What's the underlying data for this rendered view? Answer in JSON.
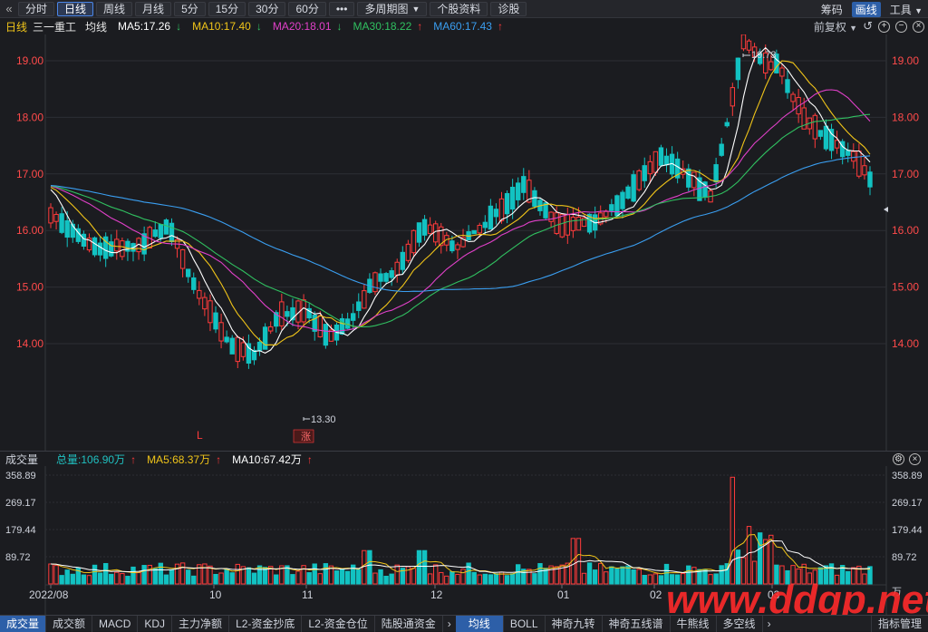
{
  "toolbar": {
    "back_icon": "«",
    "buttons": [
      {
        "label": "分时",
        "active": false
      },
      {
        "label": "日线",
        "active": true
      },
      {
        "label": "周线",
        "active": false
      },
      {
        "label": "月线",
        "active": false
      },
      {
        "label": "5分",
        "active": false
      },
      {
        "label": "15分",
        "active": false
      },
      {
        "label": "30分",
        "active": false
      },
      {
        "label": "60分",
        "active": false
      },
      {
        "label": "•••",
        "active": false
      },
      {
        "label": "多周期图",
        "active": false,
        "dropdown": true
      },
      {
        "label": "个股资料",
        "active": false
      },
      {
        "label": "诊股",
        "active": false
      }
    ],
    "right": {
      "chips": "筹码",
      "draw": "画线",
      "tools": "工具"
    }
  },
  "ma_header": {
    "period": "日线",
    "stock_name": "三一重工",
    "avg_line": "均线",
    "items": [
      {
        "label": "MA5:17.26",
        "arrow": "↓",
        "color": "#ffffff"
      },
      {
        "label": "MA10:17.40",
        "arrow": "↓",
        "color": "#f0c419"
      },
      {
        "label": "MA20:18.01",
        "arrow": "↓",
        "color": "#e040c8"
      },
      {
        "label": "MA30:18.22",
        "arrow": "↑",
        "color": "#30c060"
      },
      {
        "label": "MA60:17.43",
        "arrow": "↑",
        "color": "#3a9ef0"
      }
    ],
    "restore": "前复权"
  },
  "price_axis": {
    "ticks": [
      "19.00",
      "18.00",
      "17.00",
      "16.00",
      "15.00",
      "14.00"
    ],
    "tick_values": [
      19,
      18,
      17,
      16,
      15,
      14
    ]
  },
  "annotations": {
    "high": "19.73",
    "low": "13.30",
    "marker_l": "L",
    "marker_zhang": "涨"
  },
  "volume_header": {
    "title": "成交量",
    "items": [
      {
        "label": "总量:106.90万",
        "arrow": "↑",
        "color": "#20c0c0"
      },
      {
        "label": "MA5:68.37万",
        "arrow": "↑",
        "color": "#f0c419"
      },
      {
        "label": "MA10:67.42万",
        "arrow": "↑",
        "color": "#ffffff"
      }
    ]
  },
  "volume_axis": {
    "ticks": [
      "358.89",
      "269.17",
      "179.44",
      "89.72"
    ],
    "unit": "万"
  },
  "date_axis": [
    "2022/08",
    "10",
    "11",
    "12",
    "01",
    "02",
    "03"
  ],
  "bottom_tabs_left": [
    "成交量",
    "成交额",
    "MACD",
    "KDJ",
    "主力净额",
    "L2-资金抄底",
    "L2-资金仓位",
    "陆股通资金"
  ],
  "bottom_tabs_right": [
    "均线",
    "BOLL",
    "神奇九转",
    "神奇五线谱",
    "牛熊线",
    "多空线"
  ],
  "bottom_right": "指标管理",
  "watermark": "www.ddgp.net",
  "colors": {
    "up": "#ff3b3b",
    "down": "#12c2c2",
    "ma5": "#ffffff",
    "ma10": "#f0c419",
    "ma20": "#e040c8",
    "ma30": "#30c060",
    "ma60": "#3a9ef0"
  }
}
